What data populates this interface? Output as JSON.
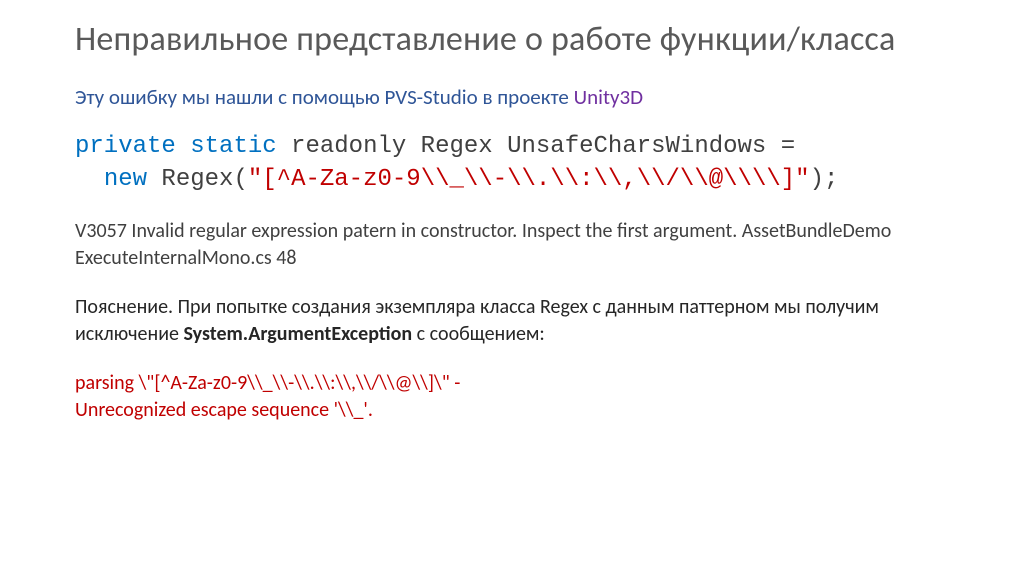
{
  "title": "Неправильное представление о работе функции/класса",
  "subtitle_prefix": "Эту ошибку мы нашли с помощью PVS-Studio в проекте ",
  "subtitle_project": "Unity3D",
  "code": {
    "kw1": "private",
    "kw2": "static",
    "rest1": " readonly Regex UnsafeCharsWindows =",
    "kw3": "new",
    "rest2": " Regex(",
    "lit": "\"[^A-Za-z0-9\\\\_\\\\-\\\\.\\\\:\\\\,\\\\/\\\\@\\\\\\\\]\"",
    "rest3": ");"
  },
  "warning": "V3057 Invalid regular expression patern in constructor. Inspect the first argument. AssetBundleDemo ExecuteInternalMono.cs 48",
  "explain_prefix": "Пояснение. При попытке создания экземпляра класса Regex с данным паттерном мы получим исключение ",
  "explain_bold": "System.ArgumentException",
  "explain_suffix": " с сообщением:",
  "error_line1": "parsing \\\"[^A-Za-z0-9\\\\_\\\\-\\\\.\\\\:\\\\,\\\\/\\\\@\\\\]\\\" -",
  "error_line2": "Unrecognized escape sequence '\\\\_'."
}
